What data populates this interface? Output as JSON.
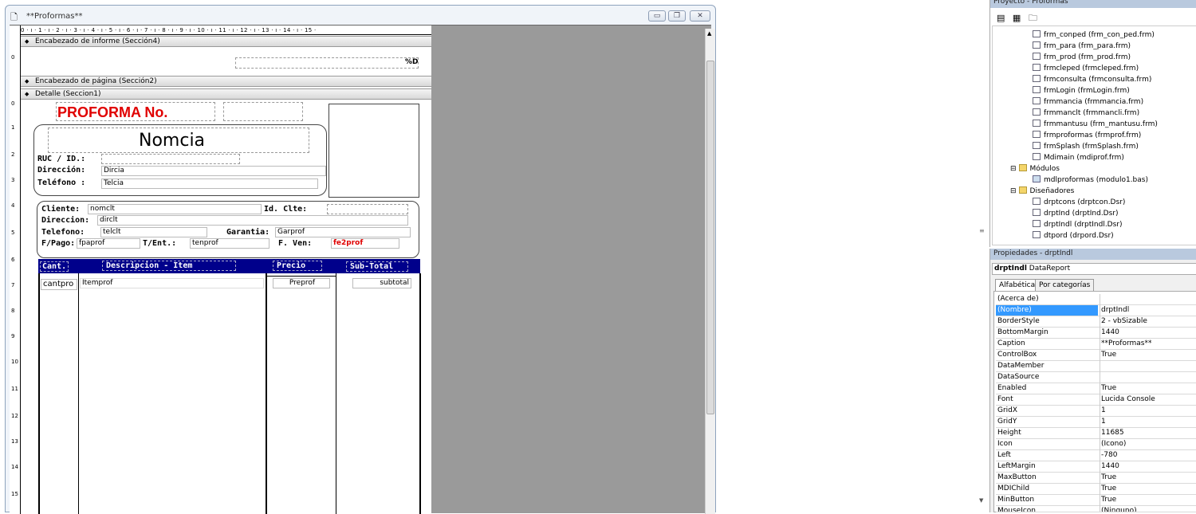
{
  "designer": {
    "title": "**Proformas**",
    "ruler_top": "0 · ı · 1 · ı · 2 · ı · 3 · ı · 4 · ı · 5 · ı · 6 · ı · 7 · ı · 8 · ı · 9 · ı · 10 · ı · 11 · ı · 12 · ı · 13 · ı · 14 · ı · 15 ·",
    "ruler_left": [
      "0",
      "1",
      "2",
      "3",
      "4",
      "5",
      "6",
      "7",
      "8",
      "9",
      "10",
      "11",
      "12",
      "13",
      "14",
      "15"
    ],
    "sections": {
      "report_header": "Encabezado de informe (Sección4)",
      "page_header": "Encabezado de página (Sección2)",
      "detail": "Detalle (Seccion1)"
    },
    "page_number": "%D",
    "proforma_title": "PROFORMA No.",
    "company_name": "Nomcia",
    "ruc_label": "RUC / ID.:",
    "direccion_label": "Dirección:",
    "direccion_value": "Dircia",
    "telefono_label": "Teléfono :",
    "telefono_value": "Telcia",
    "cliente_label": "Cliente:",
    "cliente_value": "nomclt",
    "idclte_label": "Id. Clte:",
    "direccion2_label": "Direccion:",
    "direccion2_value": "dirclt",
    "telefono2_label": "Telefono:",
    "telefono2_value": "telclt",
    "garantia_label": "Garantia:",
    "garantia_value": "Garprof",
    "fpago_label": "F/Pago:",
    "fpago_value": "fpaprof",
    "tent_label": "T/Ent.:",
    "tent_value": "tenprof",
    "fven_label": "F. Ven:",
    "fven_value": "fe2prof",
    "table_headers": [
      "Cant.",
      "Descripcion - Item",
      "Precio",
      "Sub-Total"
    ],
    "row": {
      "cant": "cantpro",
      "item": "Itemprof",
      "precio": "Preprof",
      "subtotal": "subtotal"
    }
  },
  "project": {
    "title": "Proyecto - Proformas",
    "items": [
      {
        "label": "frm_conped (frm_con_ped.frm)",
        "kind": "form"
      },
      {
        "label": "frm_para (frm_para.frm)",
        "kind": "form"
      },
      {
        "label": "frm_prod (frm_prod.frm)",
        "kind": "form"
      },
      {
        "label": "frmcleped (frmcleped.frm)",
        "kind": "form"
      },
      {
        "label": "frmconsulta (frmconsulta.frm)",
        "kind": "form"
      },
      {
        "label": "frmLogin (frmLogin.frm)",
        "kind": "form"
      },
      {
        "label": "frmmancia (frmmancia.frm)",
        "kind": "form"
      },
      {
        "label": "frmmanclt (frmmancli.frm)",
        "kind": "form"
      },
      {
        "label": "frmmantusu (frm_mantusu.frm)",
        "kind": "form"
      },
      {
        "label": "frmproformas (frmprof.frm)",
        "kind": "form"
      },
      {
        "label": "frmSplash (frmSplash.frm)",
        "kind": "form"
      },
      {
        "label": "Mdimain (mdiprof.frm)",
        "kind": "form"
      },
      {
        "label": "Módulos",
        "kind": "folder"
      },
      {
        "label": "mdlproformas (modulo1.bas)",
        "kind": "module"
      },
      {
        "label": "Diseñadores",
        "kind": "folder"
      },
      {
        "label": "drptcons (drptcon.Dsr)",
        "kind": "designer"
      },
      {
        "label": "drptInd (drptInd.Dsr)",
        "kind": "designer"
      },
      {
        "label": "drptIndl (drptIndl.Dsr)",
        "kind": "designer"
      },
      {
        "label": "dtpord (drpord.Dsr)",
        "kind": "designer"
      }
    ]
  },
  "properties": {
    "title": "Propiedades - drptIndl",
    "object": "drptIndl",
    "object_type": "DataReport",
    "tabs": [
      "Alfabética",
      "Por categorías"
    ],
    "rows": [
      {
        "name": "(Acerca de)",
        "value": ""
      },
      {
        "name": "(Nombre)",
        "value": "drptIndl"
      },
      {
        "name": "BorderStyle",
        "value": "2 - vbSizable"
      },
      {
        "name": "BottomMargin",
        "value": "1440"
      },
      {
        "name": "Caption",
        "value": "**Proformas**"
      },
      {
        "name": "ControlBox",
        "value": "True"
      },
      {
        "name": "DataMember",
        "value": ""
      },
      {
        "name": "DataSource",
        "value": ""
      },
      {
        "name": "Enabled",
        "value": "True"
      },
      {
        "name": "Font",
        "value": "Lucida Console"
      },
      {
        "name": "GridX",
        "value": "1"
      },
      {
        "name": "GridY",
        "value": "1"
      },
      {
        "name": "Height",
        "value": "11685"
      },
      {
        "name": "Icon",
        "value": "(Icono)"
      },
      {
        "name": "Left",
        "value": "-780"
      },
      {
        "name": "LeftMargin",
        "value": "1440"
      },
      {
        "name": "MaxButton",
        "value": "True"
      },
      {
        "name": "MDIChild",
        "value": "True"
      },
      {
        "name": "MinButton",
        "value": "True"
      },
      {
        "name": "MouseIcon",
        "value": "(Ninguno)"
      }
    ],
    "selected_row": "(Nombre)"
  }
}
